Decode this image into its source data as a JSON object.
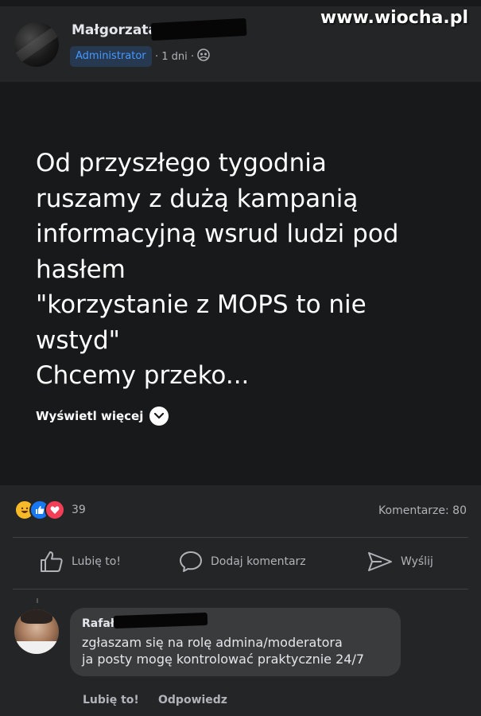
{
  "watermark": "www.wiocha.pl",
  "post": {
    "author": "Małgorzata",
    "role_badge": "Administrator",
    "separator1": "·",
    "time": "1 dni",
    "separator2": "·",
    "privacy_icon": "group-icon",
    "text": "Od przyszłego tygodnia\nruszamy z dużą kampanią\ninformacyjną wsrud ludzi pod\nhasłem\n\"korzystanie z MOPS to nie\nwstyd\"\nChcemy przeko...",
    "see_more": "Wyświetl więcej"
  },
  "stats": {
    "reactions": [
      "haha",
      "like",
      "love"
    ],
    "reaction_count": "39",
    "comments": "Komentarze: 80"
  },
  "actions": {
    "like": "Lubię to!",
    "comment": "Dodaj komentarz",
    "send": "Wyślij"
  },
  "comment": {
    "author": "Rafał",
    "text": "zgłaszam się na rolę admina/moderatora\nja posty mogę kontrolować praktycznie 24/7",
    "like": "Lubię to!",
    "reply": "Odpowiedz"
  },
  "colors": {
    "background": "#242526",
    "post_background": "#18191a",
    "badge_text": "#4599ff",
    "badge_bg": "#263951",
    "bubble": "#3a3b3c"
  }
}
